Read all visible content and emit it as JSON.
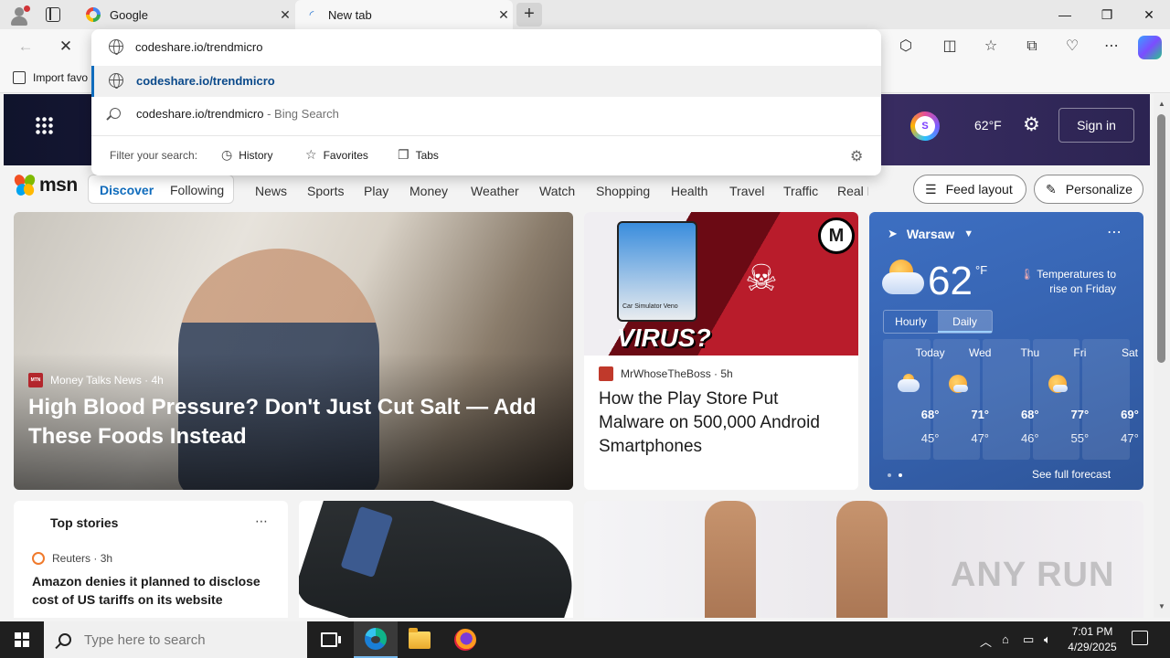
{
  "browser": {
    "tabs": [
      {
        "title": "Google",
        "active": false
      },
      {
        "title": "New tab",
        "active": true
      }
    ],
    "address": {
      "value": "codeshare.io/trendmicro",
      "suggestions": [
        {
          "text": "codeshare.io/trendmicro",
          "suffix": ""
        },
        {
          "text": "codeshare.io/trendmicro",
          "suffix": " - Bing Search"
        }
      ],
      "filter_label": "Filter your search:",
      "filters": [
        "History",
        "Favorites",
        "Tabs"
      ]
    },
    "favorites_bar": {
      "import_label": "Import favo"
    }
  },
  "msn": {
    "header": {
      "temperature": "62°F",
      "sign_in": "Sign in",
      "rewards_label": "S"
    },
    "logo_text": "msn",
    "feed_toggle": {
      "discover": "Discover",
      "following": "Following"
    },
    "categories": [
      "News",
      "Sports",
      "Play",
      "Money",
      "Weather",
      "Watch",
      "Shopping",
      "Health",
      "Travel",
      "Traffic",
      "Real E"
    ],
    "feed_layout": "Feed layout",
    "personalize": "Personalize",
    "hero": {
      "source": "Money Talks News",
      "source_logo": "MTN",
      "age": "4h",
      "title": "High Blood Pressure? Don't Just Cut Salt — Add These Foods Instead"
    },
    "card2": {
      "source": "MrWhoseTheBoss",
      "age": "5h",
      "title": "How the Play Store Put Malware on 500,000 Android Smartphones",
      "image_text": "VIRUS?",
      "app_text": "Car Simulator Veno"
    },
    "weather": {
      "location": "Warsaw",
      "temp": "62",
      "unit": "°F",
      "note": "Temperatures to rise on Friday",
      "tabs": {
        "hourly": "Hourly",
        "daily": "Daily"
      },
      "days": [
        {
          "name": "Today",
          "hi": "68°",
          "lo": "45°",
          "icon": "partly-cloudy-icon"
        },
        {
          "name": "Wed",
          "hi": "71°",
          "lo": "47°",
          "icon": "sunny-cloud-icon"
        },
        {
          "name": "Thu",
          "hi": "68°",
          "lo": "46°",
          "icon": "none"
        },
        {
          "name": "Fri",
          "hi": "77°",
          "lo": "55°",
          "icon": "sunny-cloud-icon"
        },
        {
          "name": "Sat",
          "hi": "69°",
          "lo": "47°",
          "icon": "none"
        }
      ],
      "see_full": "See full forecast"
    },
    "top_stories": {
      "heading": "Top stories",
      "source": "Reuters",
      "age": "3h",
      "title": "Amazon denies it planned to disclose cost of US tariffs on its website"
    },
    "watermark": "ANY RUN"
  },
  "taskbar": {
    "search_placeholder": "Type here to search",
    "time": "7:01 PM",
    "date": "4/29/2025"
  },
  "colors": {
    "accent": "#0f6cbd",
    "weather_bg": "#3561ad",
    "taskbar": "#1f1f1f"
  }
}
